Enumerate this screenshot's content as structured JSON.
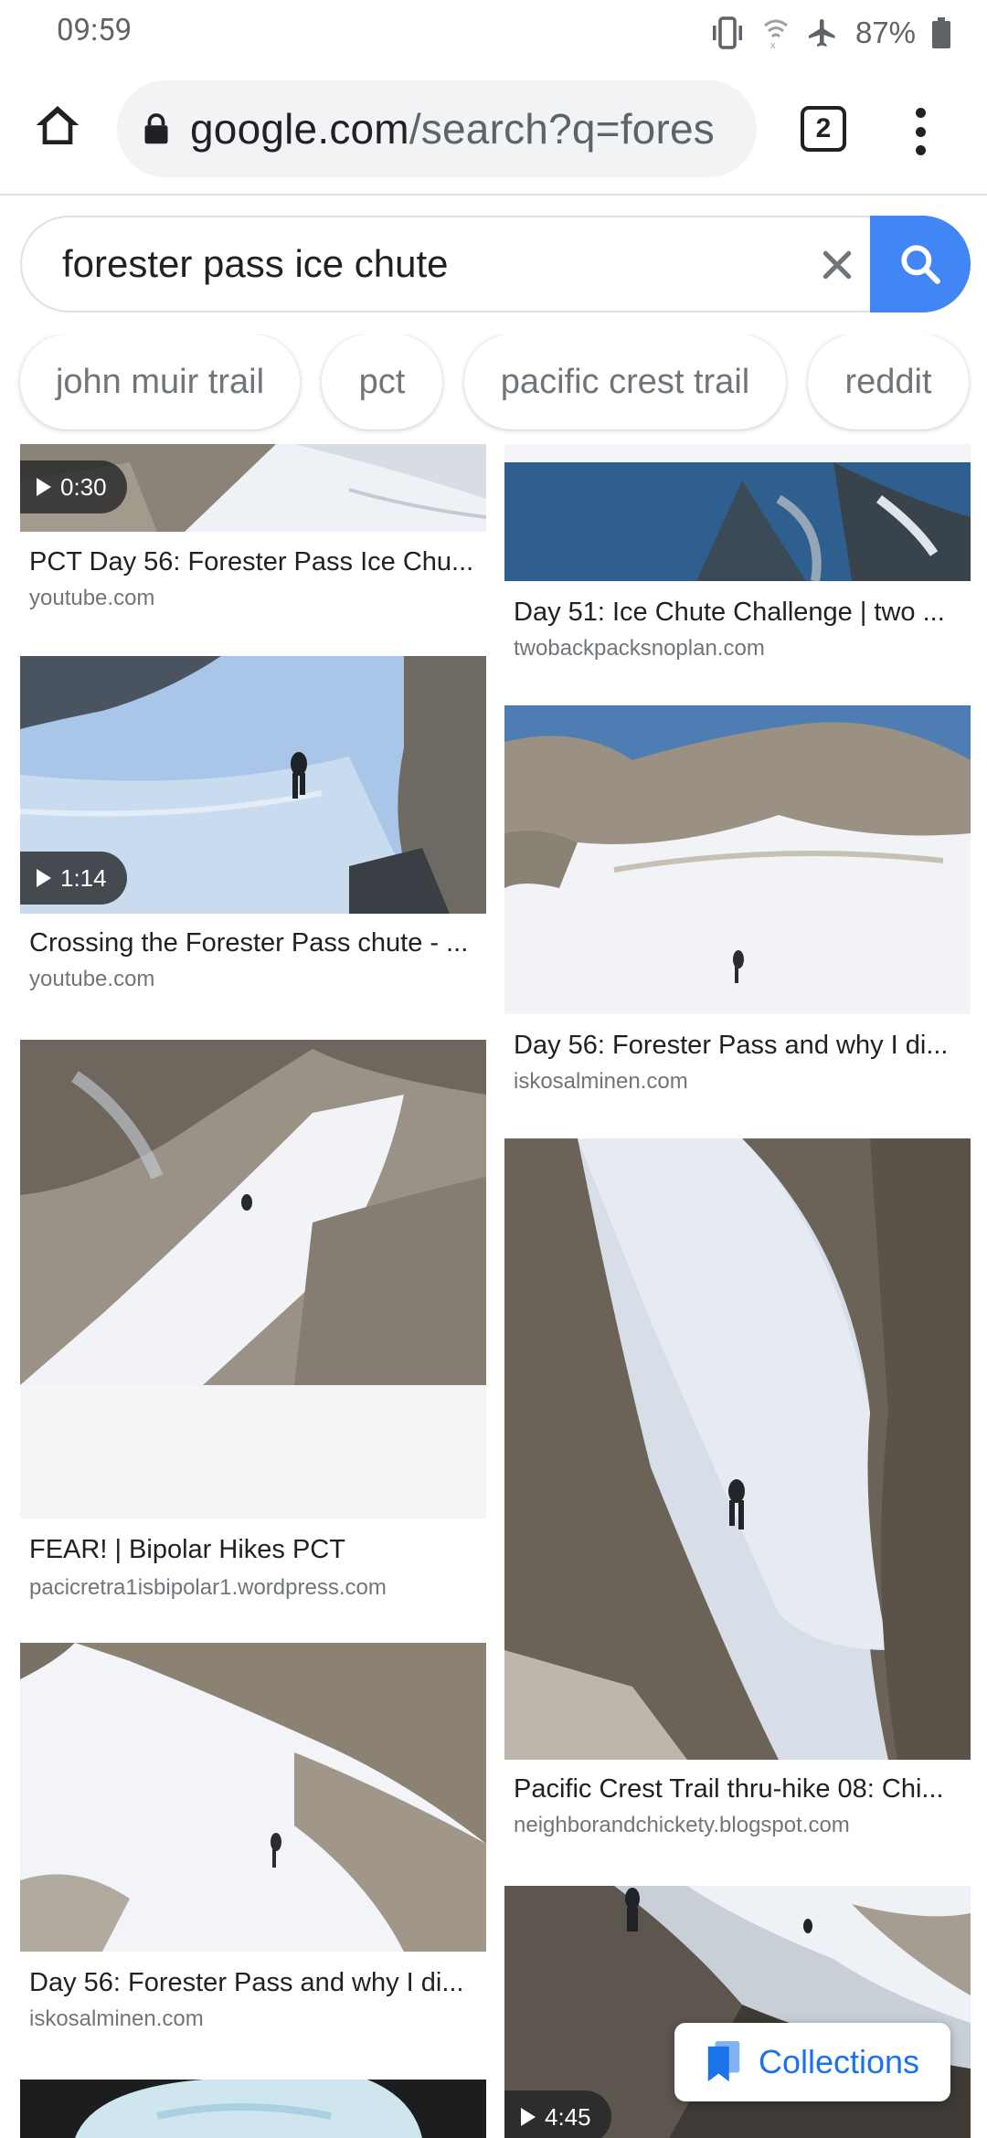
{
  "status": {
    "time": "09:59",
    "battery": "87%"
  },
  "browser": {
    "url_host": "google.com",
    "url_path": "/search?q=fores",
    "tab_count": "2"
  },
  "search": {
    "query": "forester pass ice chute"
  },
  "chips": [
    "john muir trail",
    "pct",
    "pacific crest trail",
    "reddit"
  ],
  "results": [
    {
      "title": "PCT Day 56: Forester Pass Ice Chu...",
      "source": "youtube.com",
      "duration": "0:30"
    },
    {
      "title": "Crossing the Forester Pass chute - ...",
      "source": "youtube.com",
      "duration": "1:14"
    },
    {
      "title": "FEAR! | Bipolar Hikes PCT",
      "source": "pacicretra1isbipolar1.wordpress.com"
    },
    {
      "title": "Day 56: Forester Pass and why I di...",
      "source": "iskosalminen.com"
    },
    {
      "title": "Day 51: Ice Chute Challenge | two ...",
      "source": "twobackpacksnoplan.com"
    },
    {
      "title": "Day 56: Forester Pass and why I di...",
      "source": "iskosalminen.com"
    },
    {
      "title": "Pacific Crest Trail thru-hike 08: Chi...",
      "source": "neighborandchickety.blogspot.com"
    },
    {
      "title": "",
      "source": "",
      "duration": "4:45"
    }
  ],
  "collections": {
    "label": "Collections"
  },
  "colors": {
    "accent": "#4285f4",
    "link_blue": "#1a73e8",
    "snow": "#f3f6fa",
    "rock": "#7d7468"
  }
}
